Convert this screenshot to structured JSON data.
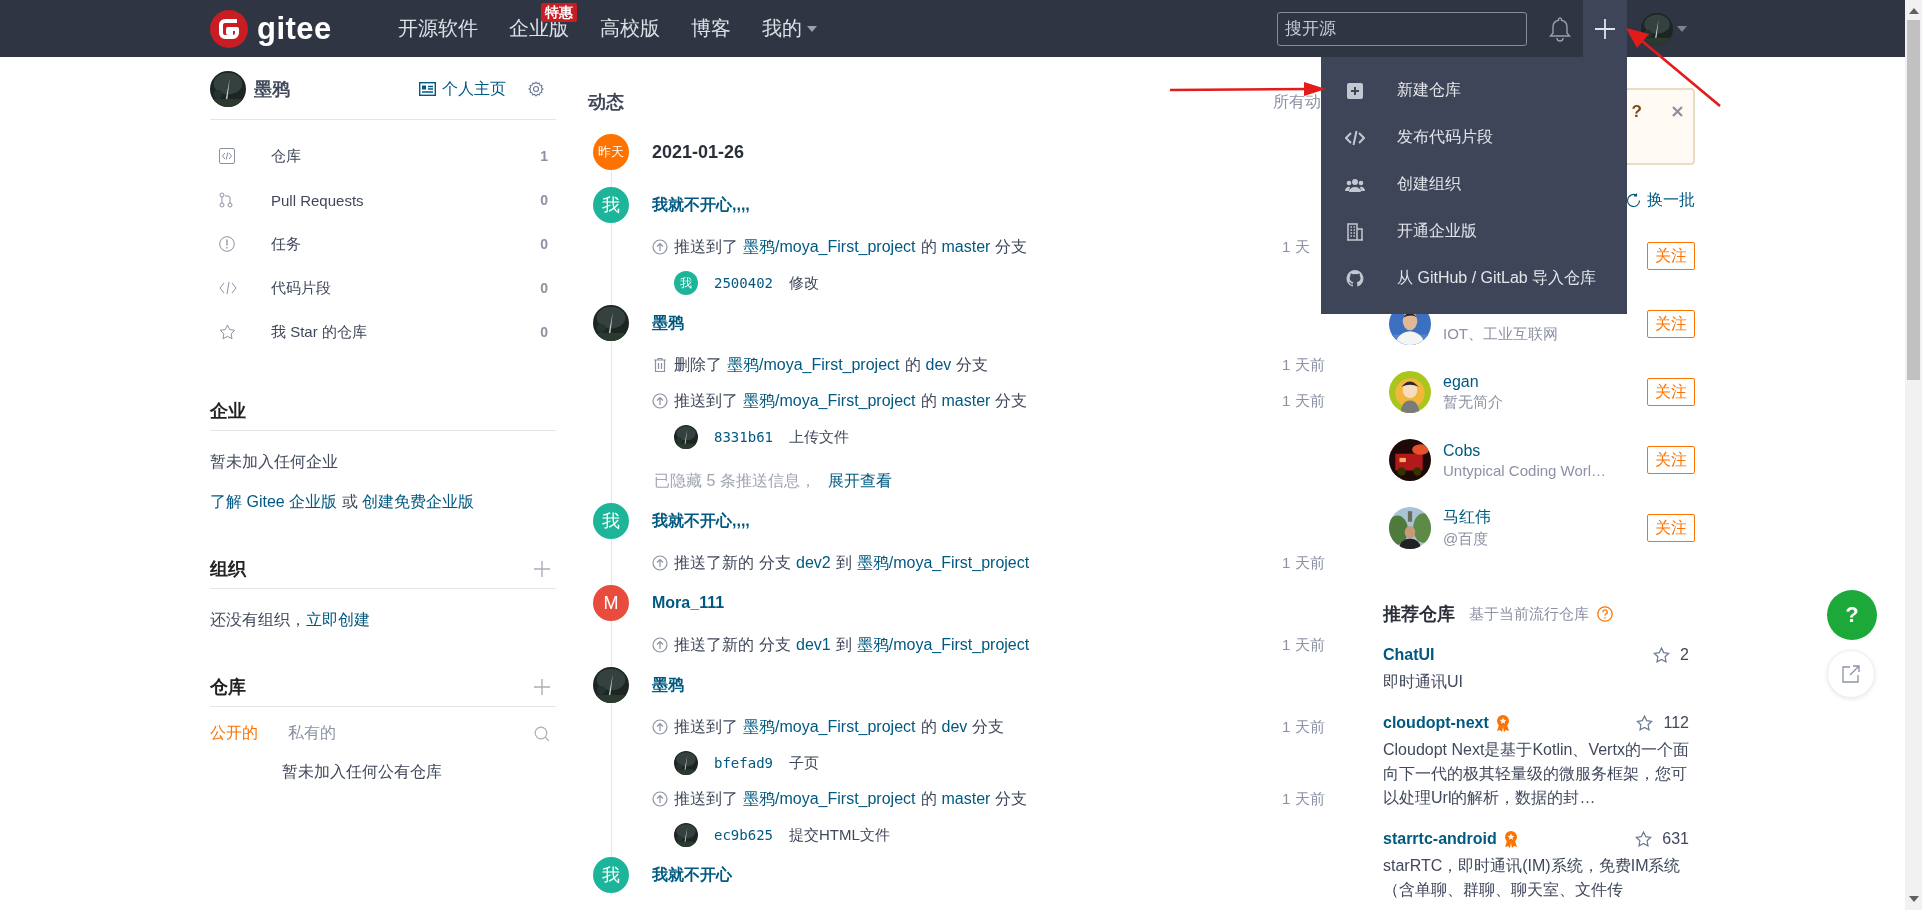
{
  "header": {
    "logo": "gitee",
    "nav": [
      {
        "label": "开源软件"
      },
      {
        "label": "企业版",
        "badge": "特惠"
      },
      {
        "label": "高校版"
      },
      {
        "label": "博客"
      },
      {
        "label": "我的",
        "has_menu": true
      }
    ],
    "search": {
      "placeholder": "搜开源"
    }
  },
  "create_menu": [
    {
      "label": "新建仓库"
    },
    {
      "label": "发布代码片段"
    },
    {
      "label": "创建组织"
    },
    {
      "label": "开通企业版"
    },
    {
      "label": "从 GitHub / GitLab 导入仓库"
    }
  ],
  "sidebar": {
    "user": {
      "name": "墨鸦",
      "homepage": "个人主页"
    },
    "menu": [
      {
        "label": "仓库",
        "count": "1"
      },
      {
        "label": "Pull Requests",
        "count": "0"
      },
      {
        "label": "任务",
        "count": "0"
      },
      {
        "label": "代码片段",
        "count": "0"
      },
      {
        "label": "我 Star 的仓库",
        "count": "0"
      }
    ],
    "enterprise": {
      "title": "企业",
      "empty": "暂未加入任何企业",
      "hint": {
        "link_1": "了解 Gitee 企业版",
        "joiner": "或",
        "link_2": "创建免费企业版"
      }
    },
    "organizations": {
      "title": "组织",
      "empty": "还没有组织，",
      "create_link": "立即创建"
    },
    "repos": {
      "title": "仓库",
      "tabs": [
        {
          "label": "公开的",
          "selected": true
        },
        {
          "label": "私有的",
          "selected": false
        }
      ],
      "empty": "暂未加入任何公有仓库"
    }
  },
  "feed": {
    "title": "动态",
    "filter": "所有动",
    "date": {
      "badge": "昨天",
      "text": "2021-01-26"
    },
    "groups": [
      {
        "avatar": {
          "kind": "letter",
          "text": "我",
          "color": "#1db59a"
        },
        "name": "我就不开心,,,,",
        "activities": [
          {
            "kind": "push",
            "parts": [
              {
                "text": "推送到了"
              },
              {
                "text": "墨鸦/moya_First_project",
                "link": true
              },
              {
                "text": "的"
              },
              {
                "text": "master",
                "link": true
              },
              {
                "text": "分支"
              }
            ],
            "time": "1 天",
            "commits": [
              {
                "avatar": {
                  "kind": "letter",
                  "text": "我",
                  "color": "#1db59a"
                },
                "sha": "2500402",
                "message": "修改"
              }
            ]
          }
        ]
      },
      {
        "avatar": {
          "kind": "picture"
        },
        "name": "墨鸦",
        "activities": [
          {
            "kind": "delete",
            "parts": [
              {
                "text": "删除了"
              },
              {
                "text": "墨鸦/moya_First_project",
                "link": true
              },
              {
                "text": "的"
              },
              {
                "text": "dev",
                "link": true
              },
              {
                "text": "分支"
              }
            ],
            "time": "1 天前"
          },
          {
            "kind": "push",
            "parts": [
              {
                "text": "推送到了"
              },
              {
                "text": "墨鸦/moya_First_project",
                "link": true
              },
              {
                "text": "的"
              },
              {
                "text": "master",
                "link": true
              },
              {
                "text": "分支"
              }
            ],
            "time": "1 天前",
            "commits": [
              {
                "avatar": {
                  "kind": "picture"
                },
                "sha": "8331b61",
                "message": "上传文件"
              }
            ]
          }
        ],
        "hidden_note": {
          "text": "已隐藏 5 条推送信息，",
          "link": "展开查看"
        }
      },
      {
        "avatar": {
          "kind": "letter",
          "text": "我",
          "color": "#1db59a"
        },
        "name": "我就不开心,,,,",
        "activities": [
          {
            "kind": "push",
            "parts": [
              {
                "text": "推送了新的"
              },
              {
                "text": "分支"
              },
              {
                "text": "dev2",
                "link": true
              },
              {
                "text": "到"
              },
              {
                "text": "墨鸦/moya_First_project",
                "link": true
              }
            ],
            "time": "1 天前"
          }
        ]
      },
      {
        "avatar": {
          "kind": "letter",
          "text": "M",
          "color": "#e84c3d"
        },
        "name": "Mora_111",
        "activities": [
          {
            "kind": "push",
            "parts": [
              {
                "text": "推送了新的"
              },
              {
                "text": "分支"
              },
              {
                "text": "dev1",
                "link": true
              },
              {
                "text": "到"
              },
              {
                "text": "墨鸦/moya_First_project",
                "link": true
              }
            ],
            "time": "1 天前"
          }
        ]
      },
      {
        "avatar": {
          "kind": "picture"
        },
        "name": "墨鸦",
        "activities": [
          {
            "kind": "push",
            "parts": [
              {
                "text": "推送到了"
              },
              {
                "text": "墨鸦/moya_First_project",
                "link": true
              },
              {
                "text": "的"
              },
              {
                "text": "dev",
                "link": true
              },
              {
                "text": "分支"
              }
            ],
            "time": "1 天前",
            "commits": [
              {
                "avatar": {
                  "kind": "picture"
                },
                "sha": "bfefad9",
                "message": "子页"
              }
            ]
          },
          {
            "kind": "push",
            "parts": [
              {
                "text": "推送到了"
              },
              {
                "text": "墨鸦/moya_First_project",
                "link": true
              },
              {
                "text": "的"
              },
              {
                "text": "master",
                "link": true
              },
              {
                "text": "分支"
              }
            ],
            "time": "1 天前",
            "commits": [
              {
                "avatar": {
                  "kind": "picture"
                },
                "sha": "ec9b625",
                "message": "提交HTML文件"
              }
            ]
          }
        ]
      },
      {
        "avatar": {
          "kind": "letter",
          "text": "我",
          "color": "#1db59a"
        },
        "name": "我就不开心"
      }
    ]
  },
  "right": {
    "notice": {
      "text": "?"
    },
    "refresh": "换一批",
    "users": [
      {
        "follow": "关注"
      },
      {
        "bio": "IOT、工业互联网",
        "follow": "关注"
      },
      {
        "name": "egan",
        "bio": "暂无简介",
        "follow": "关注"
      },
      {
        "name": "Cobs",
        "bio": "Untypical Coding Worl…",
        "follow": "关注"
      },
      {
        "name": "马红伟",
        "bio": "@百度",
        "follow": "关注"
      }
    ],
    "recommend": {
      "title": "推荐仓库",
      "subtitle": "基于当前流行仓库",
      "repos": [
        {
          "name": "ChatUI",
          "recommended": false,
          "stars": "2",
          "desc": "即时通讯UI"
        },
        {
          "name": "cloudopt-next",
          "recommended": true,
          "stars": "112",
          "desc": "Cloudopt Next是基于Kotlin、Vertx的一个面向下一代的极其轻量级的微服务框架，您可以处理Url的解析，数据的封…"
        },
        {
          "name": "starrtc-android",
          "recommended": true,
          "stars": "631",
          "desc": "starRTC，即时通讯(IM)系统，免费IM系统（含单聊、群聊、聊天室、文件传"
        }
      ]
    }
  },
  "float_buttons": {
    "help": "?"
  }
}
